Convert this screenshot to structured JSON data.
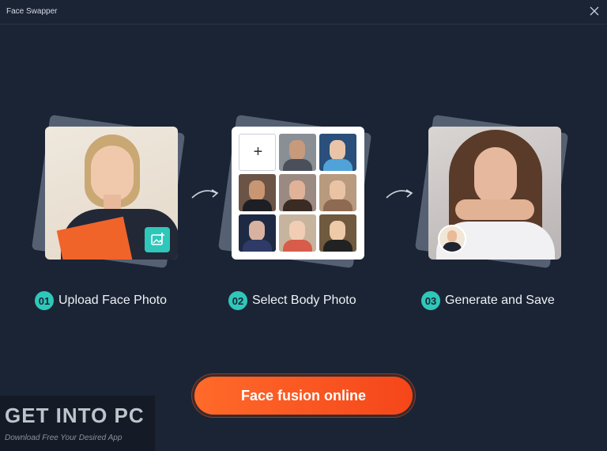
{
  "window": {
    "title": "Face Swapper",
    "close_icon": "close-icon"
  },
  "steps": [
    {
      "number": "01",
      "label": "Upload Face Photo"
    },
    {
      "number": "02",
      "label": "Select Body Photo"
    },
    {
      "number": "03",
      "label": "Generate and Save"
    }
  ],
  "body_grid": {
    "add_symbol": "+"
  },
  "cta": {
    "label": "Face fusion online"
  },
  "watermark": {
    "line1": "GET INTO PC",
    "line2": "Download Free Your Desired App"
  },
  "colors": {
    "accent_teal": "#2fc7b9",
    "cta_orange": "#f5461a",
    "background": "#1b2434"
  }
}
